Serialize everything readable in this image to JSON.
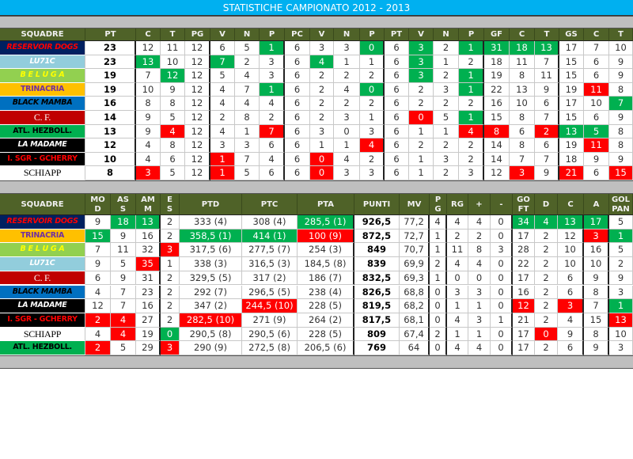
{
  "title": "STATISTICHE CAMPIONATO 2012 - 2013",
  "colors": {
    "header": "#4f6228",
    "green": "#00b050",
    "red": "#ff0000",
    "title_bar": "#00b0f0",
    "band": "#bfbfbf"
  },
  "teams": {
    "reservoir": {
      "name": "RESERVOIR DOGS",
      "bg": "#002060",
      "fg": "#ff0000",
      "style": "italic"
    },
    "lu71c": {
      "name": "LU71C",
      "bg": "#92cddc",
      "fg": "#ffffff",
      "style": "italic"
    },
    "beluga": {
      "name": "B E L U G A",
      "bg": "#92d050",
      "fg": "#ffff00",
      "style": "italic"
    },
    "trinacria": {
      "name": "TRINACRIA",
      "bg": "#ffc000",
      "fg": "#7030a0",
      "style": "normal"
    },
    "mamba": {
      "name": "BLACK MAMBA",
      "bg": "#0070c0",
      "fg": "#000000",
      "style": "italic"
    },
    "cf": {
      "name": "C. F.",
      "bg": "#c00000",
      "fg": "#ffffff",
      "style": "serif"
    },
    "atl": {
      "name": "ATL. HEZBOLL.",
      "bg": "#00b050",
      "fg": "#000000",
      "style": "normal"
    },
    "madame": {
      "name": "LA MADAME",
      "bg": "#000000",
      "fg": "#ffffff",
      "style": "italic"
    },
    "sgr": {
      "name": "I. SGR - GCHERRY",
      "bg": "#000000",
      "fg": "#ff0000",
      "style": "normal"
    },
    "schiapp": {
      "name": "SCHIAPP",
      "bg": "#ffffff",
      "fg": "#000000",
      "style": "serif"
    }
  },
  "table1": {
    "headers": [
      "SQUADRE",
      "PT",
      "C",
      "T",
      "PG",
      "V",
      "N",
      "P",
      "PC",
      "V",
      "N",
      "P",
      "PT",
      "V",
      "N",
      "P",
      "GF",
      "C",
      "T",
      "GS",
      "C",
      "T"
    ],
    "rows": [
      {
        "team": "reservoir",
        "values": [
          "23",
          "12",
          "11",
          "12",
          "6",
          "5",
          "1",
          "6",
          "3",
          "3",
          "0",
          "6",
          "3",
          "2",
          "1",
          "31",
          "18",
          "13",
          "17",
          "7",
          "10"
        ],
        "green": [
          6,
          10,
          12,
          14,
          15,
          16,
          17
        ],
        "red": []
      },
      {
        "team": "lu71c",
        "values": [
          "23",
          "13",
          "10",
          "12",
          "7",
          "2",
          "3",
          "6",
          "4",
          "1",
          "1",
          "6",
          "3",
          "1",
          "2",
          "18",
          "11",
          "7",
          "15",
          "6",
          "9"
        ],
        "green": [
          1,
          4,
          8,
          12
        ],
        "red": []
      },
      {
        "team": "beluga",
        "values": [
          "19",
          "7",
          "12",
          "12",
          "5",
          "4",
          "3",
          "6",
          "2",
          "2",
          "2",
          "6",
          "3",
          "2",
          "1",
          "19",
          "8",
          "11",
          "15",
          "6",
          "9"
        ],
        "green": [
          2,
          12,
          14
        ],
        "red": []
      },
      {
        "team": "trinacria",
        "values": [
          "19",
          "10",
          "9",
          "12",
          "4",
          "7",
          "1",
          "6",
          "2",
          "4",
          "0",
          "6",
          "2",
          "3",
          "1",
          "22",
          "13",
          "9",
          "19",
          "11",
          "8"
        ],
        "green": [
          6,
          10,
          14
        ],
        "red": [
          19
        ]
      },
      {
        "team": "mamba",
        "values": [
          "16",
          "8",
          "8",
          "12",
          "4",
          "4",
          "4",
          "6",
          "2",
          "2",
          "2",
          "6",
          "2",
          "2",
          "2",
          "16",
          "10",
          "6",
          "17",
          "10",
          "7"
        ],
        "green": [
          20
        ],
        "red": []
      },
      {
        "team": "cf",
        "values": [
          "14",
          "9",
          "5",
          "12",
          "2",
          "8",
          "2",
          "6",
          "2",
          "3",
          "1",
          "6",
          "0",
          "5",
          "1",
          "15",
          "8",
          "7",
          "15",
          "6",
          "9"
        ],
        "green": [
          14
        ],
        "red": [
          12
        ]
      },
      {
        "team": "atl",
        "values": [
          "13",
          "9",
          "4",
          "12",
          "4",
          "1",
          "7",
          "6",
          "3",
          "0",
          "3",
          "6",
          "1",
          "1",
          "4",
          "8",
          "6",
          "2",
          "13",
          "5",
          "8"
        ],
        "green": [
          18,
          19
        ],
        "red": [
          2,
          6,
          14,
          15,
          17
        ]
      },
      {
        "team": "madame",
        "values": [
          "12",
          "4",
          "8",
          "12",
          "3",
          "3",
          "6",
          "6",
          "1",
          "1",
          "4",
          "6",
          "2",
          "2",
          "2",
          "14",
          "8",
          "6",
          "19",
          "11",
          "8"
        ],
        "green": [],
        "red": [
          10,
          19
        ]
      },
      {
        "team": "sgr",
        "values": [
          "10",
          "4",
          "6",
          "12",
          "1",
          "7",
          "4",
          "6",
          "0",
          "4",
          "2",
          "6",
          "1",
          "3",
          "2",
          "14",
          "7",
          "7",
          "18",
          "9",
          "9"
        ],
        "green": [],
        "red": [
          4,
          8
        ]
      },
      {
        "team": "schiapp",
        "values": [
          "8",
          "3",
          "5",
          "12",
          "1",
          "5",
          "6",
          "6",
          "0",
          "3",
          "3",
          "6",
          "1",
          "2",
          "3",
          "12",
          "3",
          "9",
          "21",
          "6",
          "15"
        ],
        "green": [],
        "red": [
          1,
          4,
          8,
          16,
          18,
          20
        ]
      }
    ]
  },
  "table2": {
    "headers": [
      "SQUADRE",
      "MO\nD",
      "AS\nS",
      "AM\nM",
      "E\nS",
      "PTD",
      "PTC",
      "PTA",
      "PUNTI",
      "MV",
      "P\nG",
      "RG",
      "+",
      "-",
      "GO\nFT",
      "D",
      "C",
      "A",
      "GOL\nPAN"
    ],
    "rows": [
      {
        "team": "reservoir",
        "values": [
          "9",
          "18",
          "13",
          "2",
          "333 (4)",
          "308 (4)",
          "285,5 (1)",
          "926,5",
          "77,2",
          "4",
          "4",
          "4",
          "0",
          "34",
          "4",
          "13",
          "17",
          "5"
        ],
        "green": [
          1,
          2,
          6,
          13,
          14,
          15,
          16
        ],
        "red": []
      },
      {
        "team": "trinacria",
        "values": [
          "15",
          "9",
          "16",
          "2",
          "358,5 (1)",
          "414 (1)",
          "100 (9)",
          "872,5",
          "72,7",
          "1",
          "2",
          "2",
          "0",
          "17",
          "2",
          "12",
          "3",
          "1"
        ],
        "green": [
          0,
          4,
          5,
          17
        ],
        "red": [
          6,
          16
        ]
      },
      {
        "team": "beluga",
        "values": [
          "7",
          "11",
          "32",
          "3",
          "317,5 (6)",
          "277,5 (7)",
          "254 (3)",
          "849",
          "70,7",
          "1",
          "11",
          "8",
          "3",
          "28",
          "2",
          "10",
          "16",
          "5"
        ],
        "green": [],
        "red": [
          3
        ]
      },
      {
        "team": "lu71c",
        "values": [
          "9",
          "5",
          "35",
          "1",
          "338 (3)",
          "316,5 (3)",
          "184,5 (8)",
          "839",
          "69,9",
          "2",
          "4",
          "4",
          "0",
          "22",
          "2",
          "10",
          "10",
          "2"
        ],
        "green": [],
        "red": [
          2
        ]
      },
      {
        "team": "cf",
        "values": [
          "6",
          "9",
          "31",
          "2",
          "329,5 (5)",
          "317 (2)",
          "186 (7)",
          "832,5",
          "69,3",
          "1",
          "0",
          "0",
          "0",
          "17",
          "2",
          "6",
          "9",
          "9"
        ],
        "green": [],
        "red": []
      },
      {
        "team": "mamba",
        "values": [
          "4",
          "7",
          "23",
          "2",
          "292 (7)",
          "296,5 (5)",
          "238 (4)",
          "826,5",
          "68,8",
          "0",
          "3",
          "3",
          "0",
          "16",
          "2",
          "6",
          "8",
          "3"
        ],
        "green": [],
        "red": []
      },
      {
        "team": "madame",
        "values": [
          "12",
          "7",
          "16",
          "2",
          "347 (2)",
          "244,5 (10)",
          "228 (5)",
          "819,5",
          "68,2",
          "0",
          "1",
          "1",
          "0",
          "12",
          "2",
          "3",
          "7",
          "1"
        ],
        "green": [
          17
        ],
        "red": [
          5,
          13,
          15
        ]
      },
      {
        "team": "sgr",
        "values": [
          "2",
          "4",
          "27",
          "2",
          "282,5 (10)",
          "271 (9)",
          "264 (2)",
          "817,5",
          "68,1",
          "0",
          "4",
          "3",
          "1",
          "21",
          "2",
          "4",
          "15",
          "13"
        ],
        "green": [],
        "red": [
          0,
          1,
          4,
          17
        ]
      },
      {
        "team": "schiapp",
        "values": [
          "4",
          "4",
          "19",
          "0",
          "290,5 (8)",
          "290,5 (6)",
          "228 (5)",
          "809",
          "67,4",
          "2",
          "1",
          "1",
          "0",
          "17",
          "0",
          "9",
          "8",
          "10"
        ],
        "green": [
          3
        ],
        "red": [
          1,
          14
        ]
      },
      {
        "team": "atl",
        "values": [
          "2",
          "5",
          "29",
          "3",
          "290 (9)",
          "272,5 (8)",
          "206,5 (6)",
          "769",
          "64",
          "0",
          "4",
          "4",
          "0",
          "17",
          "2",
          "6",
          "9",
          "3"
        ],
        "green": [],
        "red": [
          0,
          3
        ]
      }
    ]
  }
}
